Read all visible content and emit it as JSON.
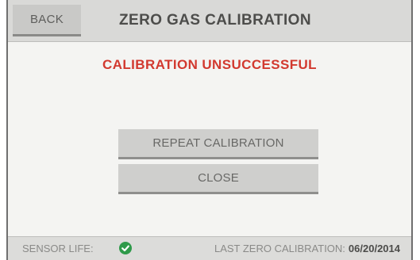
{
  "header": {
    "back_label": "BACK",
    "title": "ZERO GAS CALIBRATION"
  },
  "main": {
    "status_message": "CALIBRATION UNSUCCESSFUL",
    "buttons": {
      "repeat_label": "REPEAT CALIBRATION",
      "close_label": "CLOSE"
    }
  },
  "footer": {
    "sensor_life_label": "SENSOR LIFE:",
    "sensor_life_icon": "check-circle-icon",
    "last_calibration_label": "LAST ZERO CALIBRATION:",
    "last_calibration_date": "06/20/2014"
  },
  "colors": {
    "status_error": "#d2392f",
    "sensor_ok": "#2f9a4a"
  }
}
